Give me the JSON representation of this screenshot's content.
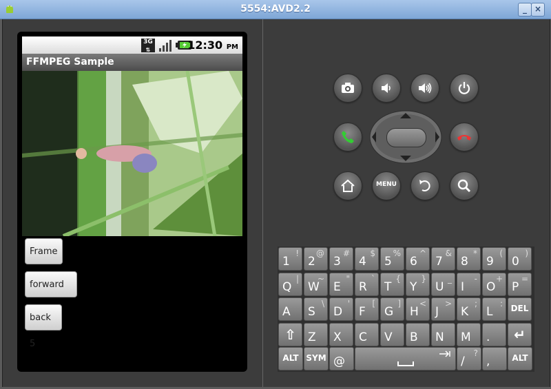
{
  "window": {
    "title": "5554:AVD2.2",
    "minimize_label": "_",
    "maximize_label": "□",
    "close_label": "×"
  },
  "statusbar": {
    "time": "12:30",
    "ampm": "PM",
    "network": "3G"
  },
  "app": {
    "title": "FFMPEG Sample",
    "buttons": {
      "frame": "Frame",
      "forward": "forward 5",
      "back": "back 5"
    }
  },
  "controls": {
    "menu_label": "MENU"
  },
  "keyboard": {
    "rows": [
      [
        {
          "m": "1",
          "a": "!"
        },
        {
          "m": "2",
          "a": "@"
        },
        {
          "m": "3",
          "a": "#"
        },
        {
          "m": "4",
          "a": "$"
        },
        {
          "m": "5",
          "a": "%"
        },
        {
          "m": "6",
          "a": "^"
        },
        {
          "m": "7",
          "a": "&"
        },
        {
          "m": "8",
          "a": "*"
        },
        {
          "m": "9",
          "a": "("
        },
        {
          "m": "0",
          "a": ")"
        }
      ],
      [
        {
          "m": "Q",
          "a": "|"
        },
        {
          "m": "W",
          "a": "~"
        },
        {
          "m": "E",
          "a": "\""
        },
        {
          "m": "R",
          "a": "`"
        },
        {
          "m": "T",
          "a": "{"
        },
        {
          "m": "Y",
          "a": "}"
        },
        {
          "m": "U",
          "a": "_"
        },
        {
          "m": "I",
          "a": "-"
        },
        {
          "m": "O",
          "a": "+"
        },
        {
          "m": "P",
          "a": "="
        }
      ],
      [
        {
          "m": "A",
          "a": ""
        },
        {
          "m": "S",
          "a": "\\"
        },
        {
          "m": "D",
          "a": "'"
        },
        {
          "m": "F",
          "a": "["
        },
        {
          "m": "G",
          "a": "]"
        },
        {
          "m": "H",
          "a": "<"
        },
        {
          "m": "J",
          "a": ">"
        },
        {
          "m": "K",
          "a": ";"
        },
        {
          "m": "L",
          "a": ":"
        },
        {
          "c": "DEL"
        }
      ],
      [
        {
          "c": "⇧"
        },
        {
          "m": "Z",
          "a": ""
        },
        {
          "m": "X",
          "a": ""
        },
        {
          "m": "C",
          "a": ""
        },
        {
          "m": "V",
          "a": ""
        },
        {
          "m": "B",
          "a": ""
        },
        {
          "m": "N",
          "a": ""
        },
        {
          "m": "M",
          "a": ""
        },
        {
          "m": ".",
          "a": ""
        },
        {
          "c": "↵"
        }
      ]
    ],
    "bottom": {
      "alt_left": "ALT",
      "sym": "SYM",
      "at": "@",
      "slash": "/",
      "slash_alt": "?",
      "comma": ",",
      "alt_right": "ALT"
    }
  }
}
